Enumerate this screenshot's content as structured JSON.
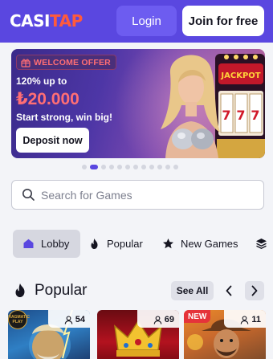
{
  "brand": {
    "name_main": "CASI",
    "name_accent": "TAP",
    "accent_color": "#ff5a3c",
    "primary_color": "#5a47e0"
  },
  "header": {
    "login_label": "Login",
    "join_label": "Join for free"
  },
  "banner": {
    "badge_label": "WELCOME OFFER",
    "line1": "120% up to",
    "amount": "₺20.000",
    "tagline": "Start strong, win big!",
    "cta_label": "Deposit now",
    "slot_sign": "JACKPOT"
  },
  "carousel": {
    "slide_count": 12,
    "active_index": 1
  },
  "search": {
    "placeholder": "Search for Games",
    "value": ""
  },
  "tabs": [
    {
      "label": "Lobby",
      "icon": "home-icon",
      "active": true
    },
    {
      "label": "Popular",
      "icon": "flame-icon",
      "active": false
    },
    {
      "label": "New Games",
      "icon": "star-icon",
      "active": false
    },
    {
      "label": "",
      "icon": "layers-icon",
      "active": false
    }
  ],
  "section": {
    "title": "Popular",
    "see_all_label": "See All"
  },
  "games": [
    {
      "players": "54",
      "badge": "",
      "provider": "PRAGMATIC PLAY"
    },
    {
      "players": "69",
      "badge": ""
    },
    {
      "players": "11",
      "badge": "NEW"
    }
  ]
}
